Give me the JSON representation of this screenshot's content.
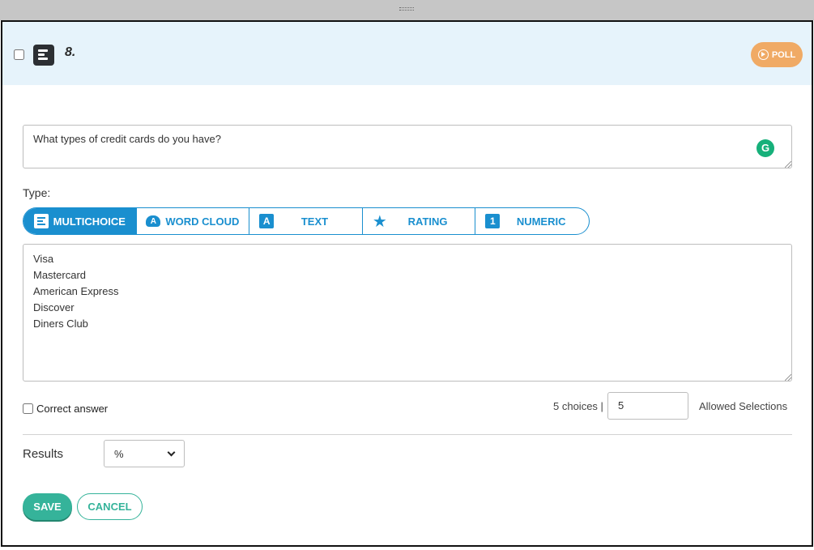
{
  "question": {
    "number": "8.",
    "badge_label": "POLL",
    "text": "What types of credit cards do you have?"
  },
  "type_section": {
    "label": "Type:",
    "tabs": [
      {
        "label": "MULTICHOICE",
        "icon": "list-icon",
        "active": true
      },
      {
        "label": "WORD CLOUD",
        "icon": "cloud-icon",
        "active": false
      },
      {
        "label": "TEXT",
        "icon": "text-icon",
        "icon_glyph": "A",
        "active": false
      },
      {
        "label": "RATING",
        "icon": "star-icon",
        "active": false
      },
      {
        "label": "NUMERIC",
        "icon": "numeric-icon",
        "icon_glyph": "1",
        "active": false
      }
    ]
  },
  "choices": [
    "Visa",
    "Mastercard",
    "American Express",
    "Discover",
    "Diners Club"
  ],
  "options": {
    "correct_answer_label": "Correct answer",
    "choices_count": "5 choices |",
    "allowed_value": "5",
    "allowed_label": "Allowed Selections"
  },
  "results": {
    "label": "Results",
    "selected": "%"
  },
  "buttons": {
    "save": "SAVE",
    "cancel": "CANCEL"
  },
  "colors": {
    "accent_blue": "#1a8fcf",
    "poll_orange": "#f0aa65",
    "save_green": "#35b39a",
    "header_bg": "#e6f3fb"
  }
}
